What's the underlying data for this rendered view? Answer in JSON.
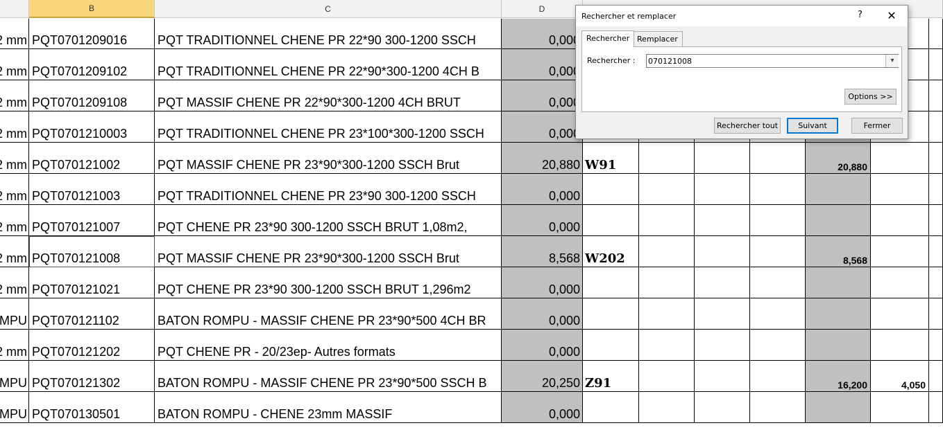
{
  "columns": {
    "B": "B",
    "C": "C",
    "D": "D"
  },
  "rows": [
    {
      "a": "2 mm",
      "code": "PQT0701209016",
      "desc": "PQT TRADITIONNEL CHENE PR 22*90 300-1200 SSCH",
      "qty": "0,000",
      "loc": "",
      "total": "",
      "extra": ""
    },
    {
      "a": "2 mm",
      "code": "PQT0701209102",
      "desc": "PQT TRADITIONNEL CHENE PR 22*90*300-1200 4CH B",
      "qty": "0,000",
      "loc": "",
      "total": "",
      "extra": ""
    },
    {
      "a": "2 mm",
      "code": "PQT0701209108",
      "desc": "PQT MASSIF CHENE PR 22*90*300-1200 4CH BRUT",
      "qty": "0,000",
      "loc": "",
      "total": "",
      "extra": ""
    },
    {
      "a": "2 mm",
      "code": "PQT0701210003",
      "desc": "PQT TRADITIONNEL CHENE PR 23*100*300-1200 SSCH",
      "qty": "0,000",
      "loc": "",
      "total": "",
      "extra": ""
    },
    {
      "a": "2 mm",
      "code": "PQT070121002",
      "desc": "PQT MASSIF CHENE PR 23*90*300-1200 SSCH Brut",
      "qty": "20,880",
      "loc": "W91",
      "total": "20,880",
      "extra": ""
    },
    {
      "a": "2 mm",
      "code": "PQT070121003",
      "desc": "PQT TRADITIONNEL CHENE PR 23*90 300-1200 SSCH",
      "qty": "0,000",
      "loc": "",
      "total": "",
      "extra": ""
    },
    {
      "a": "2 mm",
      "code": "PQT070121007",
      "desc": "PQT CHENE PR 23*90 300-1200 SSCH BRUT 1,08m2,",
      "qty": "0,000",
      "loc": "",
      "total": "",
      "extra": ""
    },
    {
      "a": "2 mm",
      "code": "PQT070121008",
      "desc": "PQT MASSIF CHENE PR 23*90*300-1200 SSCH Brut",
      "qty": "8,568",
      "loc": "W202",
      "total": "8,568",
      "extra": ""
    },
    {
      "a": "2 mm",
      "code": "PQT070121021",
      "desc": "PQT CHENE PR 23*90 300-1200 SSCH BRUT 1,296m2",
      "qty": "0,000",
      "loc": "",
      "total": "",
      "extra": ""
    },
    {
      "a": "OMPU",
      "code": "PQT070121102",
      "desc": "BATON ROMPU - MASSIF CHENE PR 23*90*500 4CH BR",
      "qty": "0,000",
      "loc": "",
      "total": "",
      "extra": ""
    },
    {
      "a": "2 mm",
      "code": "PQT070121202",
      "desc": "PQT CHENE PR - 20/23ep- Autres formats",
      "qty": "0,000",
      "loc": "",
      "total": "",
      "extra": ""
    },
    {
      "a": "OMPU",
      "code": "PQT070121302",
      "desc": "BATON ROMPU - MASSIF CHENE PR 23*90*500 SSCH B",
      "qty": "20,250",
      "loc": "Z91",
      "total": "16,200",
      "extra": "4,050"
    },
    {
      "a": "OMPU",
      "code": "PQT070130501",
      "desc": "BATON ROMPU - CHENE 23mm MASSIF",
      "qty": "0,000",
      "loc": "",
      "total": "",
      "extra": ""
    }
  ],
  "dialog": {
    "title": "Rechercher et remplacer",
    "help": "?",
    "close": "✕",
    "tab_find": "Rechercher",
    "tab_replace": "Remplacer",
    "find_label": "Rechercher :",
    "find_value": "070121008",
    "dropdown_glyph": "▾",
    "options_label": "Options >>",
    "find_all_label": "Rechercher tout",
    "next_label": "Suivant",
    "close_label": "Fermer"
  }
}
